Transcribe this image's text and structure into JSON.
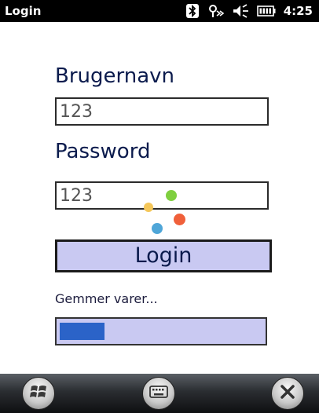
{
  "statusbar": {
    "title": "Login",
    "time": "4:25",
    "icons": [
      "bluetooth-icon",
      "signal-icon",
      "volume-icon",
      "battery-icon"
    ]
  },
  "form": {
    "username_label": "Brugernavn",
    "username_value": "123",
    "password_label": "Password",
    "password_value": "123",
    "login_button": "Login"
  },
  "status": {
    "text": "Gemmer varer...",
    "progress": 0.22
  },
  "colors": {
    "accent": "#2b63c8",
    "button_bg": "#c9c9f2",
    "label_color": "#0b1b4d"
  },
  "taskbar": {
    "icons": [
      "windows-start-icon",
      "keyboard-icon",
      "close-icon"
    ]
  }
}
